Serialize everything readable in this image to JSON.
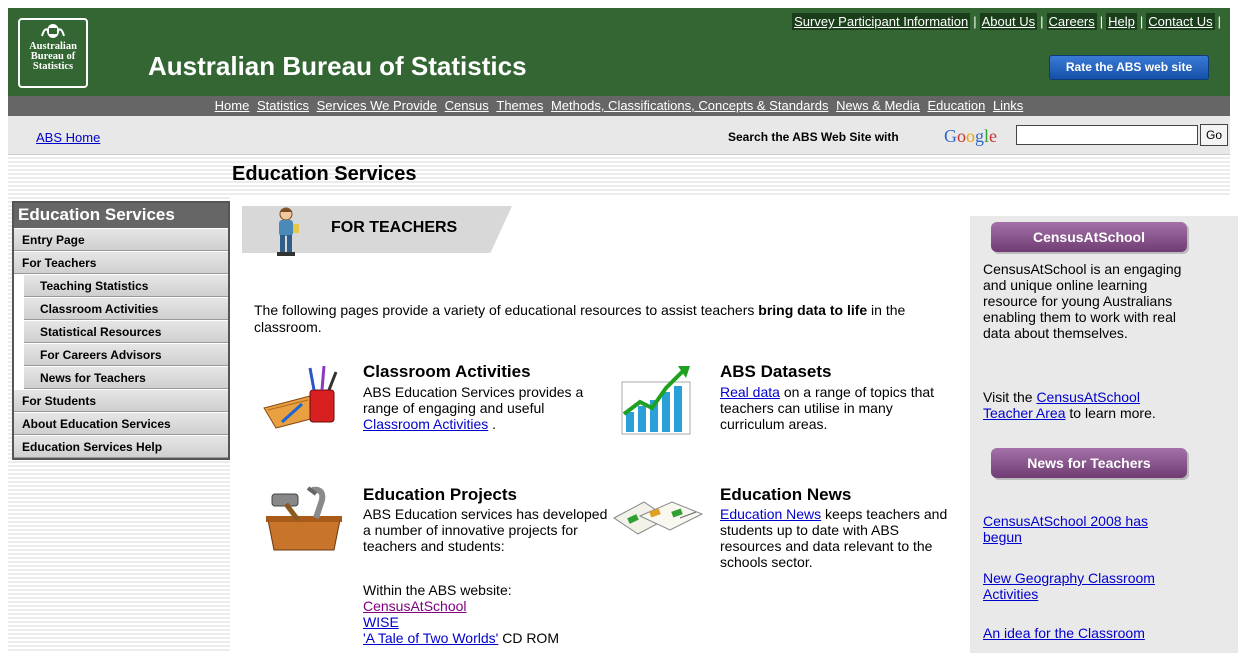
{
  "header": {
    "logo_lines": [
      "Australian",
      "Bureau of",
      "Statistics"
    ],
    "site_title": "Australian Bureau of Statistics",
    "top_links": [
      "Survey Participant Information",
      "About Us",
      "Careers",
      "Help",
      "Contact Us"
    ],
    "rate_button": "Rate the ABS web site"
  },
  "nav": [
    "Home",
    "Statistics",
    "Services We Provide",
    "Census",
    "Themes",
    "Methods, Classifications, Concepts & Standards",
    "News & Media",
    "Education",
    "Links"
  ],
  "search": {
    "home_link": "ABS Home",
    "label": "Search the ABS Web Site with",
    "engine": "Google",
    "value": "",
    "go": "Go"
  },
  "page_title": "Education Services",
  "sidebar": {
    "heading": "Education Services",
    "items": [
      {
        "label": "Entry Page",
        "sub": false
      },
      {
        "label": "For Teachers",
        "sub": false
      },
      {
        "label": "Teaching Statistics",
        "sub": true
      },
      {
        "label": "Classroom Activities",
        "sub": true
      },
      {
        "label": "Statistical Resources",
        "sub": true
      },
      {
        "label": "For Careers Advisors",
        "sub": true
      },
      {
        "label": "News for Teachers",
        "sub": true
      },
      {
        "label": "For Students",
        "sub": false
      },
      {
        "label": "About Education Services",
        "sub": false
      },
      {
        "label": "Education Services Help",
        "sub": false
      }
    ]
  },
  "main": {
    "banner_title": "FOR TEACHERS",
    "intro_before": "The following pages provide a variety of educational resources to assist teachers ",
    "intro_bold": "bring data to life",
    "intro_after": " in the classroom.",
    "classroom": {
      "title": "Classroom Activities",
      "text": "ABS Education Services provides a range of engaging and useful",
      "link": "Classroom Activities",
      "after": " ."
    },
    "datasets": {
      "title": "ABS Datasets",
      "link": "Real data",
      "text": " on a range of topics that teachers can utilise in many curriculum areas."
    },
    "projects": {
      "title": "Education Projects",
      "text": "ABS Education services has developed a number of innovative projects for teachers and students:",
      "within": "Within the ABS website:",
      "links": [
        "CensusAtSchool",
        "WISE",
        "'A Tale of Two Worlds'"
      ],
      "cd_suffix": " CD ROM"
    },
    "news": {
      "title": "Education News",
      "link": "Education News",
      "text": " keeps teachers and students up to date with ABS resources and data relevant to the schools sector."
    }
  },
  "right": {
    "census_pill": "CensusAtSchool",
    "census_text": "CensusAtSchool is an engaging and unique online learning resource for young Australians enabling them to work with real data about themselves.",
    "visit_before": "Visit the ",
    "visit_link": "CensusAtSchool Teacher Area",
    "visit_after": " to learn more.",
    "news_pill": "News for Teachers",
    "news_links": [
      "CensusAtSchool 2008 has begun",
      "New Geography Classroom Activities",
      "An idea for the Classroom"
    ]
  }
}
